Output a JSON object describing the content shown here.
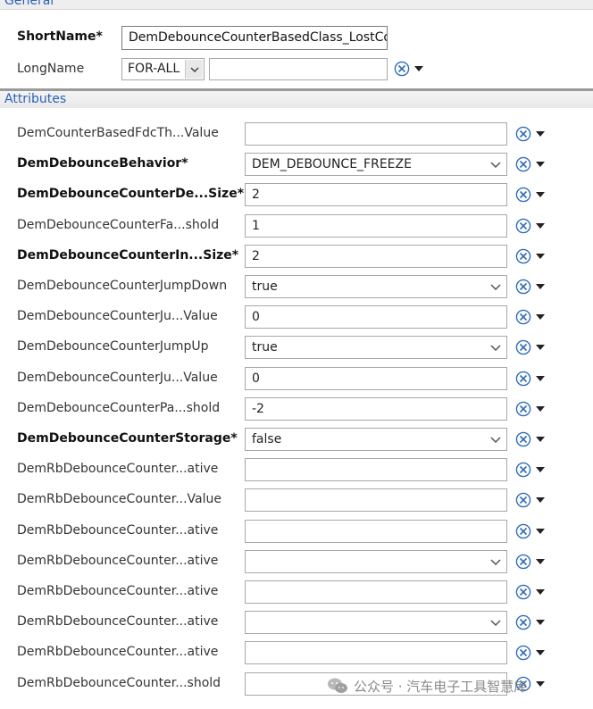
{
  "general": {
    "header": "General",
    "shortname_label": "ShortName*",
    "shortname_value": "DemDebounceCounterBasedClass_LostCom",
    "longname_label": "LongName",
    "language_value": "FOR-ALL",
    "longname_value": ""
  },
  "attributes": {
    "header": "Attributes",
    "rows": [
      {
        "label": "DemCounterBasedFdcTh...Value",
        "value": "",
        "kind": "text",
        "bold": false
      },
      {
        "label": "DemDebounceBehavior*",
        "value": "DEM_DEBOUNCE_FREEZE",
        "kind": "combo",
        "bold": true
      },
      {
        "label": "DemDebounceCounterDe...Size*",
        "value": "2",
        "kind": "text",
        "bold": true
      },
      {
        "label": "DemDebounceCounterFa...shold",
        "value": "1",
        "kind": "text",
        "bold": false
      },
      {
        "label": "DemDebounceCounterIn...Size*",
        "value": "2",
        "kind": "text",
        "bold": true
      },
      {
        "label": "DemDebounceCounterJumpDown",
        "value": "true",
        "kind": "combo",
        "bold": false
      },
      {
        "label": "DemDebounceCounterJu...Value",
        "value": "0",
        "kind": "text",
        "bold": false
      },
      {
        "label": "DemDebounceCounterJumpUp",
        "value": "true",
        "kind": "combo",
        "bold": false
      },
      {
        "label": "DemDebounceCounterJu...Value",
        "value": "0",
        "kind": "text",
        "bold": false
      },
      {
        "label": "DemDebounceCounterPa...shold",
        "value": "-2",
        "kind": "text",
        "bold": false
      },
      {
        "label": "DemDebounceCounterStorage*",
        "value": "false",
        "kind": "combo",
        "bold": true
      },
      {
        "label": "DemRbDebounceCounter...ative",
        "value": "",
        "kind": "text",
        "bold": false
      },
      {
        "label": "DemRbDebounceCounter...Value",
        "value": "",
        "kind": "text",
        "bold": false
      },
      {
        "label": "DemRbDebounceCounter...ative",
        "value": "",
        "kind": "text",
        "bold": false
      },
      {
        "label": "DemRbDebounceCounter...ative",
        "value": "",
        "kind": "combo",
        "bold": false
      },
      {
        "label": "DemRbDebounceCounter...ative",
        "value": "",
        "kind": "text",
        "bold": false
      },
      {
        "label": "DemRbDebounceCounter...ative",
        "value": "",
        "kind": "combo",
        "bold": false
      },
      {
        "label": "DemRbDebounceCounter...ative",
        "value": "",
        "kind": "text",
        "bold": false
      },
      {
        "label": "DemRbDebounceCounter...shold",
        "value": "",
        "kind": "text",
        "bold": false
      }
    ]
  },
  "icons": {
    "reset": "reset-x-icon",
    "dropdown": "dropdown-triangle-icon",
    "chevron": "chevron-down-icon"
  },
  "colors": {
    "section_header_text": "#2b62b8",
    "icon_blue": "#2f6db8"
  },
  "watermark": "公众号 · 汽车电子工具智慧库"
}
